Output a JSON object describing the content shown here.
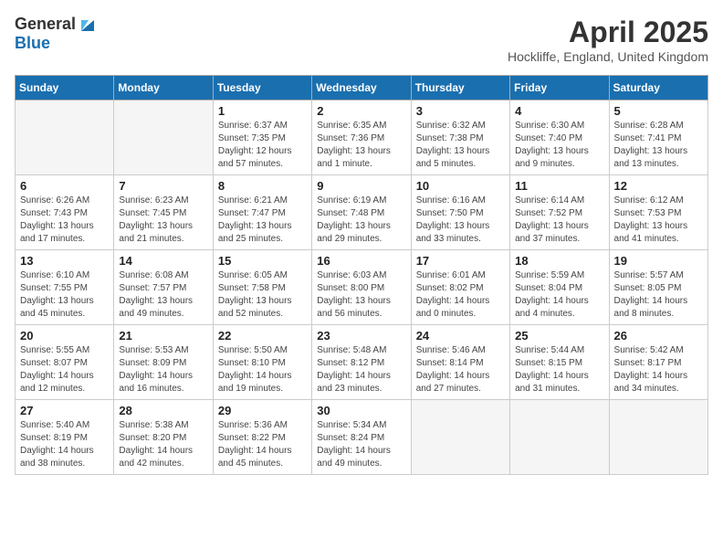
{
  "header": {
    "logo_general": "General",
    "logo_blue": "Blue",
    "month_title": "April 2025",
    "location": "Hockliffe, England, United Kingdom"
  },
  "weekdays": [
    "Sunday",
    "Monday",
    "Tuesday",
    "Wednesday",
    "Thursday",
    "Friday",
    "Saturday"
  ],
  "weeks": [
    [
      {
        "day": "",
        "empty": true
      },
      {
        "day": "",
        "empty": true
      },
      {
        "day": "1",
        "sunrise": "Sunrise: 6:37 AM",
        "sunset": "Sunset: 7:35 PM",
        "daylight": "Daylight: 12 hours and 57 minutes."
      },
      {
        "day": "2",
        "sunrise": "Sunrise: 6:35 AM",
        "sunset": "Sunset: 7:36 PM",
        "daylight": "Daylight: 13 hours and 1 minute."
      },
      {
        "day": "3",
        "sunrise": "Sunrise: 6:32 AM",
        "sunset": "Sunset: 7:38 PM",
        "daylight": "Daylight: 13 hours and 5 minutes."
      },
      {
        "day": "4",
        "sunrise": "Sunrise: 6:30 AM",
        "sunset": "Sunset: 7:40 PM",
        "daylight": "Daylight: 13 hours and 9 minutes."
      },
      {
        "day": "5",
        "sunrise": "Sunrise: 6:28 AM",
        "sunset": "Sunset: 7:41 PM",
        "daylight": "Daylight: 13 hours and 13 minutes."
      }
    ],
    [
      {
        "day": "6",
        "sunrise": "Sunrise: 6:26 AM",
        "sunset": "Sunset: 7:43 PM",
        "daylight": "Daylight: 13 hours and 17 minutes."
      },
      {
        "day": "7",
        "sunrise": "Sunrise: 6:23 AM",
        "sunset": "Sunset: 7:45 PM",
        "daylight": "Daylight: 13 hours and 21 minutes."
      },
      {
        "day": "8",
        "sunrise": "Sunrise: 6:21 AM",
        "sunset": "Sunset: 7:47 PM",
        "daylight": "Daylight: 13 hours and 25 minutes."
      },
      {
        "day": "9",
        "sunrise": "Sunrise: 6:19 AM",
        "sunset": "Sunset: 7:48 PM",
        "daylight": "Daylight: 13 hours and 29 minutes."
      },
      {
        "day": "10",
        "sunrise": "Sunrise: 6:16 AM",
        "sunset": "Sunset: 7:50 PM",
        "daylight": "Daylight: 13 hours and 33 minutes."
      },
      {
        "day": "11",
        "sunrise": "Sunrise: 6:14 AM",
        "sunset": "Sunset: 7:52 PM",
        "daylight": "Daylight: 13 hours and 37 minutes."
      },
      {
        "day": "12",
        "sunrise": "Sunrise: 6:12 AM",
        "sunset": "Sunset: 7:53 PM",
        "daylight": "Daylight: 13 hours and 41 minutes."
      }
    ],
    [
      {
        "day": "13",
        "sunrise": "Sunrise: 6:10 AM",
        "sunset": "Sunset: 7:55 PM",
        "daylight": "Daylight: 13 hours and 45 minutes."
      },
      {
        "day": "14",
        "sunrise": "Sunrise: 6:08 AM",
        "sunset": "Sunset: 7:57 PM",
        "daylight": "Daylight: 13 hours and 49 minutes."
      },
      {
        "day": "15",
        "sunrise": "Sunrise: 6:05 AM",
        "sunset": "Sunset: 7:58 PM",
        "daylight": "Daylight: 13 hours and 52 minutes."
      },
      {
        "day": "16",
        "sunrise": "Sunrise: 6:03 AM",
        "sunset": "Sunset: 8:00 PM",
        "daylight": "Daylight: 13 hours and 56 minutes."
      },
      {
        "day": "17",
        "sunrise": "Sunrise: 6:01 AM",
        "sunset": "Sunset: 8:02 PM",
        "daylight": "Daylight: 14 hours and 0 minutes."
      },
      {
        "day": "18",
        "sunrise": "Sunrise: 5:59 AM",
        "sunset": "Sunset: 8:04 PM",
        "daylight": "Daylight: 14 hours and 4 minutes."
      },
      {
        "day": "19",
        "sunrise": "Sunrise: 5:57 AM",
        "sunset": "Sunset: 8:05 PM",
        "daylight": "Daylight: 14 hours and 8 minutes."
      }
    ],
    [
      {
        "day": "20",
        "sunrise": "Sunrise: 5:55 AM",
        "sunset": "Sunset: 8:07 PM",
        "daylight": "Daylight: 14 hours and 12 minutes."
      },
      {
        "day": "21",
        "sunrise": "Sunrise: 5:53 AM",
        "sunset": "Sunset: 8:09 PM",
        "daylight": "Daylight: 14 hours and 16 minutes."
      },
      {
        "day": "22",
        "sunrise": "Sunrise: 5:50 AM",
        "sunset": "Sunset: 8:10 PM",
        "daylight": "Daylight: 14 hours and 19 minutes."
      },
      {
        "day": "23",
        "sunrise": "Sunrise: 5:48 AM",
        "sunset": "Sunset: 8:12 PM",
        "daylight": "Daylight: 14 hours and 23 minutes."
      },
      {
        "day": "24",
        "sunrise": "Sunrise: 5:46 AM",
        "sunset": "Sunset: 8:14 PM",
        "daylight": "Daylight: 14 hours and 27 minutes."
      },
      {
        "day": "25",
        "sunrise": "Sunrise: 5:44 AM",
        "sunset": "Sunset: 8:15 PM",
        "daylight": "Daylight: 14 hours and 31 minutes."
      },
      {
        "day": "26",
        "sunrise": "Sunrise: 5:42 AM",
        "sunset": "Sunset: 8:17 PM",
        "daylight": "Daylight: 14 hours and 34 minutes."
      }
    ],
    [
      {
        "day": "27",
        "sunrise": "Sunrise: 5:40 AM",
        "sunset": "Sunset: 8:19 PM",
        "daylight": "Daylight: 14 hours and 38 minutes."
      },
      {
        "day": "28",
        "sunrise": "Sunrise: 5:38 AM",
        "sunset": "Sunset: 8:20 PM",
        "daylight": "Daylight: 14 hours and 42 minutes."
      },
      {
        "day": "29",
        "sunrise": "Sunrise: 5:36 AM",
        "sunset": "Sunset: 8:22 PM",
        "daylight": "Daylight: 14 hours and 45 minutes."
      },
      {
        "day": "30",
        "sunrise": "Sunrise: 5:34 AM",
        "sunset": "Sunset: 8:24 PM",
        "daylight": "Daylight: 14 hours and 49 minutes."
      },
      {
        "day": "",
        "empty": true
      },
      {
        "day": "",
        "empty": true
      },
      {
        "day": "",
        "empty": true
      }
    ]
  ]
}
